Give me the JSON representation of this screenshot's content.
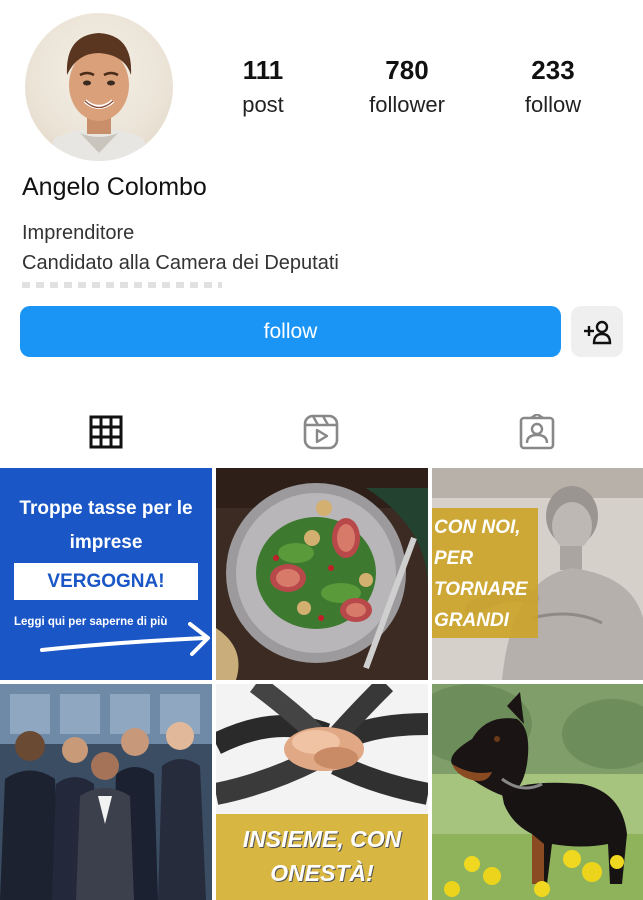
{
  "profile": {
    "name": "Angelo Colombo",
    "bio_line1": "Imprenditore",
    "bio_line2": "Candidato alla Camera dei Deputati"
  },
  "stats": [
    {
      "value": "111",
      "label": "post"
    },
    {
      "value": "780",
      "label": "follower"
    },
    {
      "value": "233",
      "label": "follow"
    }
  ],
  "actions": {
    "follow_label": "follow",
    "add_icon": "add-person-icon"
  },
  "tabs": [
    {
      "icon": "grid-icon",
      "active": true
    },
    {
      "icon": "reels-icon",
      "active": false
    },
    {
      "icon": "tagged-icon",
      "active": false
    }
  ],
  "posts": {
    "p1": {
      "headline_1": "Troppe tasse per le",
      "headline_2": "imprese",
      "band": "VERGOGNA!",
      "sub": "Leggi qui per saperne di più"
    },
    "p3": {
      "line1": "CON NOI,",
      "line2": "PER",
      "line3": "TORNARE",
      "line4": "GRANDI"
    },
    "p5": {
      "line1": "INSIEME, CON",
      "line2": "ONESTÀ!"
    }
  },
  "colors": {
    "accent": "#1a95f5",
    "post1_bg": "#1a56c6",
    "yellow": "#d8b642"
  }
}
